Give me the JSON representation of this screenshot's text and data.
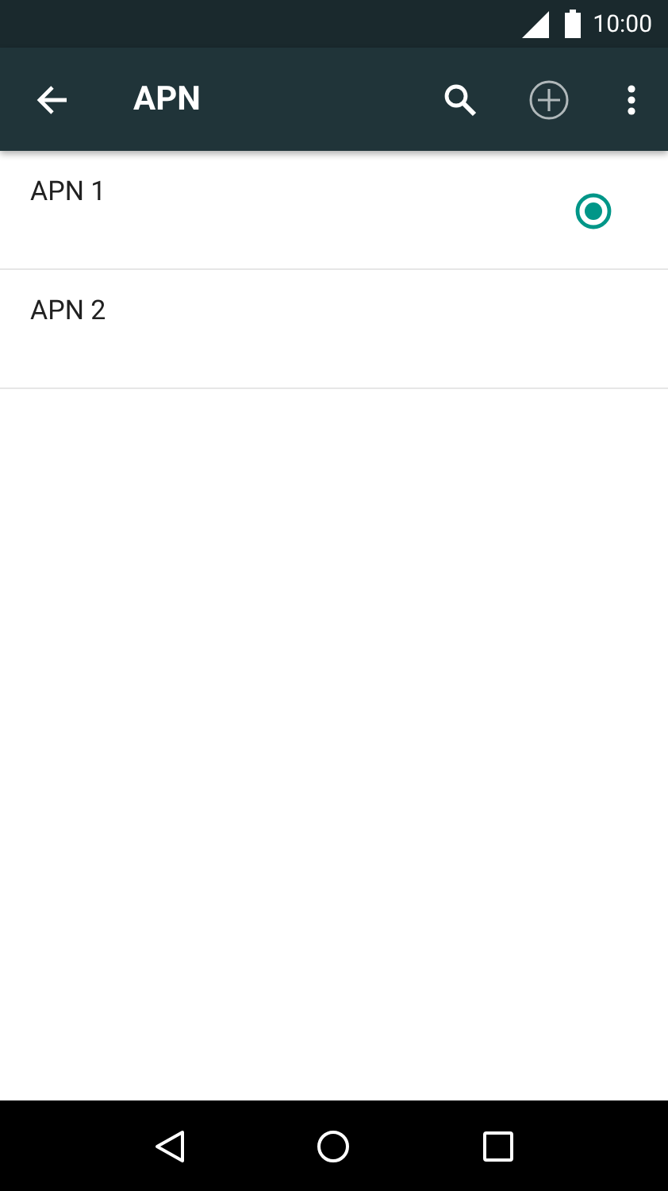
{
  "status_bar": {
    "time": "10:00"
  },
  "app_bar": {
    "title": "APN"
  },
  "apns": [
    {
      "name": "APN 1",
      "selected": true
    },
    {
      "name": "APN 2",
      "selected": false
    }
  ]
}
